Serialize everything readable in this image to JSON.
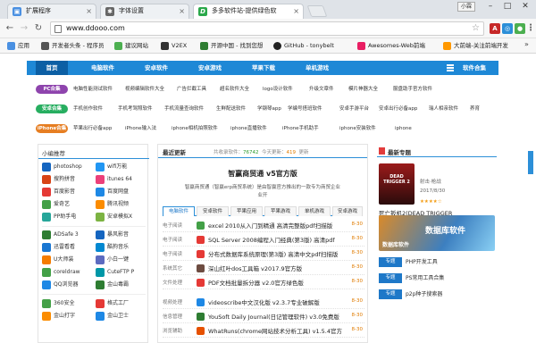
{
  "browser": {
    "tabs": [
      {
        "label": "扩展程序",
        "icon_color": "#4a90e2"
      },
      {
        "label": "字体设置",
        "icon_color": "#555555"
      },
      {
        "label": "多多软件站-提供绿色软",
        "icon_color": "#2aa84a"
      }
    ],
    "profile_label": "小霖",
    "window_buttons": [
      "–",
      "□",
      "✕"
    ],
    "nav": {
      "back": "←",
      "forward": "→",
      "reload": "↻"
    },
    "url": "www.ddooo.com",
    "star": "☆",
    "extensions": [
      {
        "name": "abp-extension",
        "color": "#c62828",
        "glyph": "A"
      },
      {
        "name": "globe-extension",
        "color": "#2c8fd8",
        "glyph": "◎"
      },
      {
        "name": "green-extension",
        "color": "#4caf50",
        "glyph": "●"
      },
      {
        "name": "menu-icon",
        "color": "#666666",
        "glyph": "⋮"
      }
    ],
    "bookmarks": [
      {
        "label": "应用",
        "color": "#4a90e2"
      },
      {
        "label": "开发者头条 - 程序员",
        "color": "#555555"
      },
      {
        "label": "建议网站",
        "color": "#4caf50"
      },
      {
        "label": "V2EX",
        "color": "#333333"
      },
      {
        "label": "开源中国 - 找到您想",
        "color": "#2e7d32"
      },
      {
        "label": "GitHub - tonybelt",
        "color": "#222222"
      },
      {
        "label": "Awesomes-Web前端",
        "color": "#e91e63"
      },
      {
        "label": "大前端-关注前端开发",
        "color": "#ff9800"
      }
    ],
    "bookmarks_more": "»"
  },
  "nav": {
    "items": [
      "首页",
      "电脑软件",
      "安卓软件",
      "安卓游戏",
      "苹果下载",
      "单机游戏"
    ],
    "right": "软件合集"
  },
  "categories": [
    {
      "badge": "PC合集",
      "color": "#8e44ad",
      "items": [
        "电脑性能测试软件",
        "视频编辑软件大全",
        "广告拦截工具",
        "超名软件大全",
        "logo设计软件",
        "升级文章件",
        "模片神器大全",
        "服盘助手官方软件"
      ]
    },
    {
      "badge": "安卓合集",
      "color": "#27ae60",
      "items": [
        "手机创作软件",
        "手机考驾照软件",
        "手机流量查询软件",
        "生鲜配送软件",
        "学钢琴app",
        "学编号搭班软件",
        "安卓手游平台",
        "安卓出行必备app",
        "瑞人相亲软件",
        "养育"
      ]
    },
    {
      "badge": "iPhone合集",
      "color": "#e67e22",
      "items": [
        "苹果出行必备app",
        "iPhone输入法",
        "iphone相机拍照软件",
        "iphone直播软件",
        "iPhone手机助手",
        "iphone安装软件",
        "iphone"
      ]
    }
  ],
  "left": {
    "title": "小编推荐",
    "groups": [
      [
        {
          "label": "photoshop",
          "color": "#1565c0"
        },
        {
          "label": "wifi万能",
          "color": "#2196f3"
        },
        {
          "label": "搜狗拼音",
          "color": "#d84315"
        },
        {
          "label": "itunes 64",
          "color": "#ec407a"
        },
        {
          "label": "百度影音",
          "color": "#e53935"
        },
        {
          "label": "百度网盘",
          "color": "#1e88e5"
        },
        {
          "label": "爱奇艺",
          "color": "#43a047"
        },
        {
          "label": "腾讯视频",
          "color": "#fb8c00"
        },
        {
          "label": "PP助手电",
          "color": "#26a69a"
        },
        {
          "label": "安卓模拟X",
          "color": "#7cb342"
        }
      ],
      [
        {
          "label": "ADSafe 3",
          "color": "#2e7d32"
        },
        {
          "label": "暴风影音",
          "color": "#1565c0"
        },
        {
          "label": "迅雷看看",
          "color": "#1976d2"
        },
        {
          "label": "酷狗音乐",
          "color": "#0288d1"
        },
        {
          "label": "U大师装",
          "color": "#f57c00"
        },
        {
          "label": "小白一键",
          "color": "#5c6bc0"
        },
        {
          "label": "coreldraw",
          "color": "#43a047"
        },
        {
          "label": "CuteFTP P",
          "color": "#0097a7"
        },
        {
          "label": "QQ浏览器",
          "color": "#1e88e5"
        },
        {
          "label": "金山毒霸",
          "color": "#2e7d32"
        }
      ],
      [
        {
          "label": "360安全",
          "color": "#43a047"
        },
        {
          "label": "格式工厂",
          "color": "#e53935"
        },
        {
          "label": "金山打字",
          "color": "#fb8c00"
        },
        {
          "label": "金山卫士",
          "color": "#1e88e5"
        }
      ]
    ]
  },
  "center": {
    "title": "最近更新",
    "stats": {
      "total_label": "共收录软件：",
      "total": "76742",
      "today_label": "今天更新：",
      "today": "419",
      "update_label": "更新",
      "update": ""
    },
    "featured_title": "智赢商贸通 v5官方版",
    "featured_desc": "智赢商贸通（智赢erp商贸系统）是由智赢官方推出的一款专为商贸企业",
    "featured_desc2": "业开",
    "tabs": [
      "电脑软件",
      "安卓软件",
      "苹果应用",
      "苹果游戏",
      "单机游戏",
      "安卓游戏"
    ],
    "rows": [
      {
        "cat": "电子阅读",
        "name": "excel 2010从入门到精通 高清完整版pdf扫描版",
        "date": "8-30",
        "color": "#43a047"
      },
      {
        "cat": "电子阅读",
        "name": "SQL Server 2008编程入门经典(第3版) 高清pdf",
        "date": "8-30",
        "color": "#e53935"
      },
      {
        "cat": "电子阅读",
        "name": "分布式数据库系统原理(第3版) 高清中文pdf扫描版",
        "date": "8-30",
        "color": "#e53935"
      },
      {
        "cat": "系统其它",
        "name": "深山红叶dos工具箱 v2017.9官方版",
        "date": "8-30",
        "color": "#6d4c41"
      },
      {
        "cat": "文件处理",
        "name": "PDF文档批量拆分器 v2.0官方绿色版",
        "date": "8-30",
        "color": "#e53935"
      },
      {
        "cat": "视频处理",
        "name": "videoscribe中文汉化版 v2.3.7专业破解版",
        "date": "8-30",
        "color": "#1e88e5"
      },
      {
        "cat": "信息管理",
        "name": "YouSoft Daily Journal(日记管理软件) v3.0免费版",
        "date": "8-30",
        "color": "#2e7d32"
      },
      {
        "cat": "浏览辅助",
        "name": "WhatRuns(chrome网站技术分析工具) v1.5.4官方",
        "date": "8-30",
        "color": "#e65100"
      }
    ]
  },
  "right": {
    "title": "最新专题",
    "game": {
      "art_text": "DEAD TRIGGER 2",
      "name": "死亡扳机2(DEAD TRIGGER",
      "date": "2017/8/30",
      "meta": "射击·枪战",
      "rating": "★★★★☆"
    },
    "banner_title": "数据库软件",
    "banner_sub": "数据库软件",
    "specials": [
      {
        "tag": "专题",
        "text": "PHP开发工具"
      },
      {
        "tag": "专题",
        "text": "PS常用工具合集"
      },
      {
        "tag": "专题",
        "text": "p2p种子搜索器"
      }
    ]
  }
}
